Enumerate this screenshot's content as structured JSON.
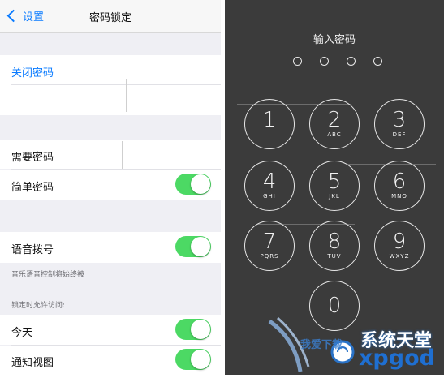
{
  "left": {
    "nav": {
      "back_label": "设置",
      "title": "密码锁定"
    },
    "turn_off_passcode": "关闭密码",
    "require_passcode": "需要密码",
    "simple_passcode": {
      "label": "简单密码",
      "on": true
    },
    "voice_dial": {
      "label": "语音拨号",
      "on": true
    },
    "voice_dial_note": "音乐语音控制将始终被",
    "allow_access_header": "锁定时允许访问:",
    "today": {
      "label": "今天",
      "on": true
    },
    "notifications_view": {
      "label": "通知视图",
      "on": true
    }
  },
  "right": {
    "title": "输入密码",
    "dot_count": 4,
    "keys": [
      {
        "num": "1",
        "letters": ""
      },
      {
        "num": "2",
        "letters": "ABC"
      },
      {
        "num": "3",
        "letters": "DEF"
      },
      {
        "num": "4",
        "letters": "GHI"
      },
      {
        "num": "5",
        "letters": "JKL"
      },
      {
        "num": "6",
        "letters": "MNO"
      },
      {
        "num": "7",
        "letters": "PQRS"
      },
      {
        "num": "8",
        "letters": "TUV"
      },
      {
        "num": "9",
        "letters": "WXYZ"
      },
      {
        "num": "0",
        "letters": ""
      }
    ]
  },
  "watermark": {
    "cn": "系统天堂",
    "en": "xpgod",
    "small": "我爱下载"
  },
  "colors": {
    "ios_blue": "#0a7bff",
    "toggle_green": "#4cd964",
    "keypad_bg": "#3b3b3b"
  }
}
